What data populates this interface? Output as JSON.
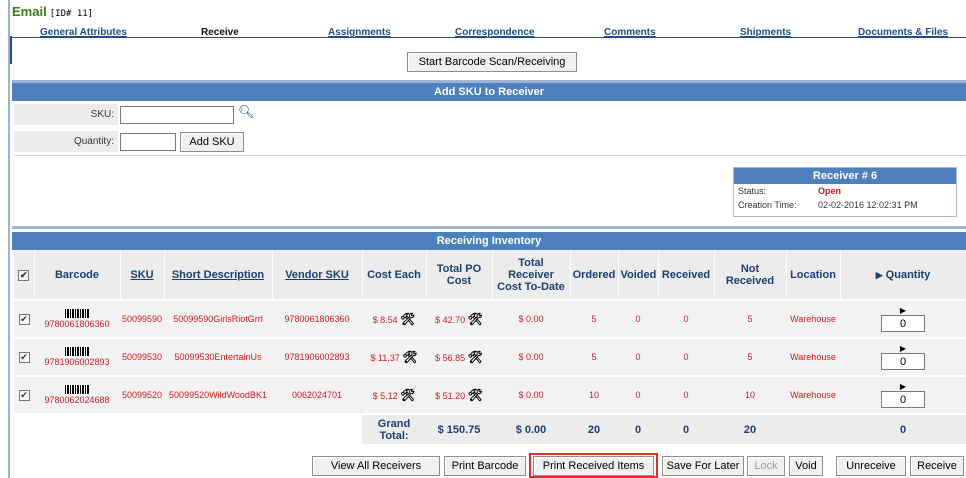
{
  "header": {
    "title": "Email",
    "id_tag": "[ID# 11]"
  },
  "tabs": [
    {
      "label": "General Attributes",
      "active": false
    },
    {
      "label": "Receive",
      "active": true
    },
    {
      "label": "Assignments",
      "active": false
    },
    {
      "label": "Correspondence",
      "active": false
    },
    {
      "label": "Comments",
      "active": false
    },
    {
      "label": "Shipments",
      "active": false
    },
    {
      "label": "Documents & Files",
      "active": false
    }
  ],
  "start_scan_label": "Start Barcode Scan/Receiving",
  "add_sku": {
    "title": "Add SKU to Receiver",
    "sku_label": "SKU:",
    "sku_value": "",
    "quantity_label": "Quantity:",
    "quantity_value": "",
    "add_button": "Add SKU",
    "search_icon": "magnifier-icon"
  },
  "receiver": {
    "title": "Receiver # 6",
    "status_label": "Status:",
    "status_value": "Open",
    "created_label": "Creation Time:",
    "created_value": "02-02-2016 12:02:31 PM"
  },
  "inventory": {
    "title": "Receiving Inventory",
    "columns": [
      "Barcode",
      "SKU",
      "Short Description",
      "Vendor SKU",
      "Cost Each",
      "Total PO Cost",
      "Total Receiver Cost To-Date",
      "Ordered",
      "Voided",
      "Received",
      "Not Received",
      "Location",
      "Quantity"
    ],
    "rows": [
      {
        "barcode": "9780061806360",
        "sku": "50099590",
        "desc": "50099590GirlsRiotGrrl",
        "vendor_sku": "9780061806360",
        "cost_each": "$ 8.54",
        "total_po": "$ 42.70",
        "total_recv": "$ 0.00",
        "ordered": "5",
        "voided": "0",
        "received": "0",
        "not_received": "5",
        "location": "Warehouse",
        "quantity": "0"
      },
      {
        "barcode": "9781906002893",
        "sku": "50099530",
        "desc": "50099530EntertainUs",
        "vendor_sku": "9781906002893",
        "cost_each": "$ 11.37",
        "total_po": "$ 56.85",
        "total_recv": "$ 0.00",
        "ordered": "5",
        "voided": "0",
        "received": "0",
        "not_received": "5",
        "location": "Warehouse",
        "quantity": "0"
      },
      {
        "barcode": "9780062024688",
        "sku": "50099520",
        "desc": "50099520WildWoodBK1",
        "vendor_sku": "0062024701",
        "cost_each": "$ 5.12",
        "total_po": "$ 51.20",
        "total_recv": "$ 0.00",
        "ordered": "10",
        "voided": "0",
        "received": "0",
        "not_received": "10",
        "location": "Warehouse",
        "quantity": "0"
      }
    ],
    "totals": {
      "label": "Grand Total:",
      "total_po": "$ 150.75",
      "total_recv": "$ 0.00",
      "ordered": "20",
      "voided": "0",
      "received": "0",
      "not_received": "20",
      "quantity": "0"
    }
  },
  "actions": {
    "view_all": "View All Receivers",
    "print_barcode": "Print Barcode",
    "print_received": "Print Received Items",
    "save_later": "Save For Later",
    "lock": "Lock",
    "void": "Void",
    "unreceive": "Unreceive",
    "receive": "Receive"
  },
  "colors": {
    "accent_bar": "#4d80bd",
    "value_red": "#cc1f1f",
    "title_green": "#3a7a12",
    "highlight": "#e0302a"
  }
}
